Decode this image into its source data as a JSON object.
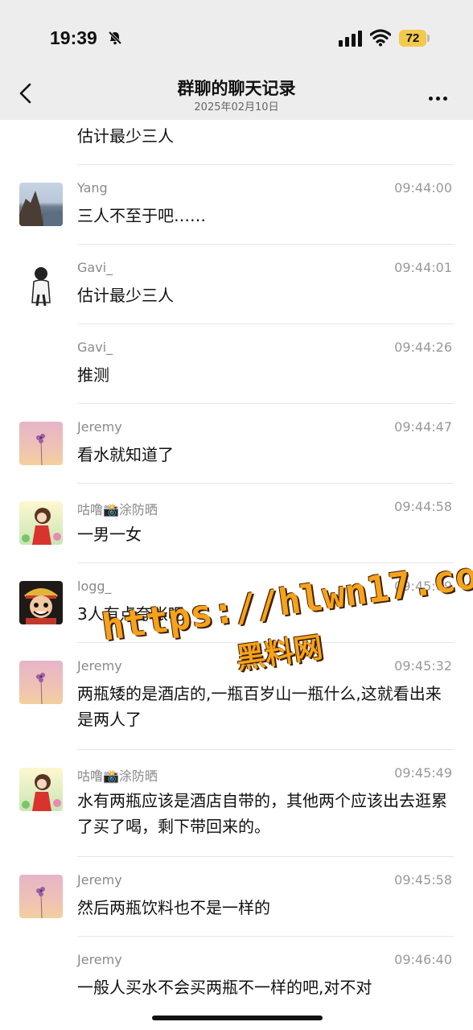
{
  "status": {
    "time": "19:39",
    "battery": "72"
  },
  "nav": {
    "title": "群聊的聊天记录",
    "subtitle": "2025年02月10日"
  },
  "messages": [
    {
      "sender": "",
      "time": "",
      "text": "估计最少三人"
    },
    {
      "sender": "Yang",
      "time": "09:44:00",
      "text": "三人不至于吧……"
    },
    {
      "sender": "Gavi_",
      "time": "09:44:01",
      "text": "估计最少三人"
    },
    {
      "sender": "Gavi_",
      "time": "09:44:26",
      "text": "推测"
    },
    {
      "sender": "Jeremy",
      "time": "09:44:47",
      "text": "看水就知道了"
    },
    {
      "sender": "咕噜📸涂防晒",
      "time": "09:44:58",
      "text": "一男一女"
    },
    {
      "sender": "logg_",
      "time": "09:45:09",
      "text": "3人有点夸张吧"
    },
    {
      "sender": "Jeremy",
      "time": "09:45:32",
      "text": "两瓶矮的是酒店的,一瓶百岁山一瓶什么,这就看出来是两人了"
    },
    {
      "sender": "咕噜📸涂防晒",
      "time": "09:45:49",
      "text": "水有两瓶应该是酒店自带的，其他两个应该出去逛累了买了喝，剩下带回来的。"
    },
    {
      "sender": "Jeremy",
      "time": "09:45:58",
      "text": "然后两瓶饮料也不是一样的"
    },
    {
      "sender": "Jeremy",
      "time": "09:46:40",
      "text": "一般人买水不会买两瓶不一样的吧,对不对"
    }
  ],
  "watermark": {
    "url": "https://hlwn17.com",
    "name": "黑料网"
  }
}
